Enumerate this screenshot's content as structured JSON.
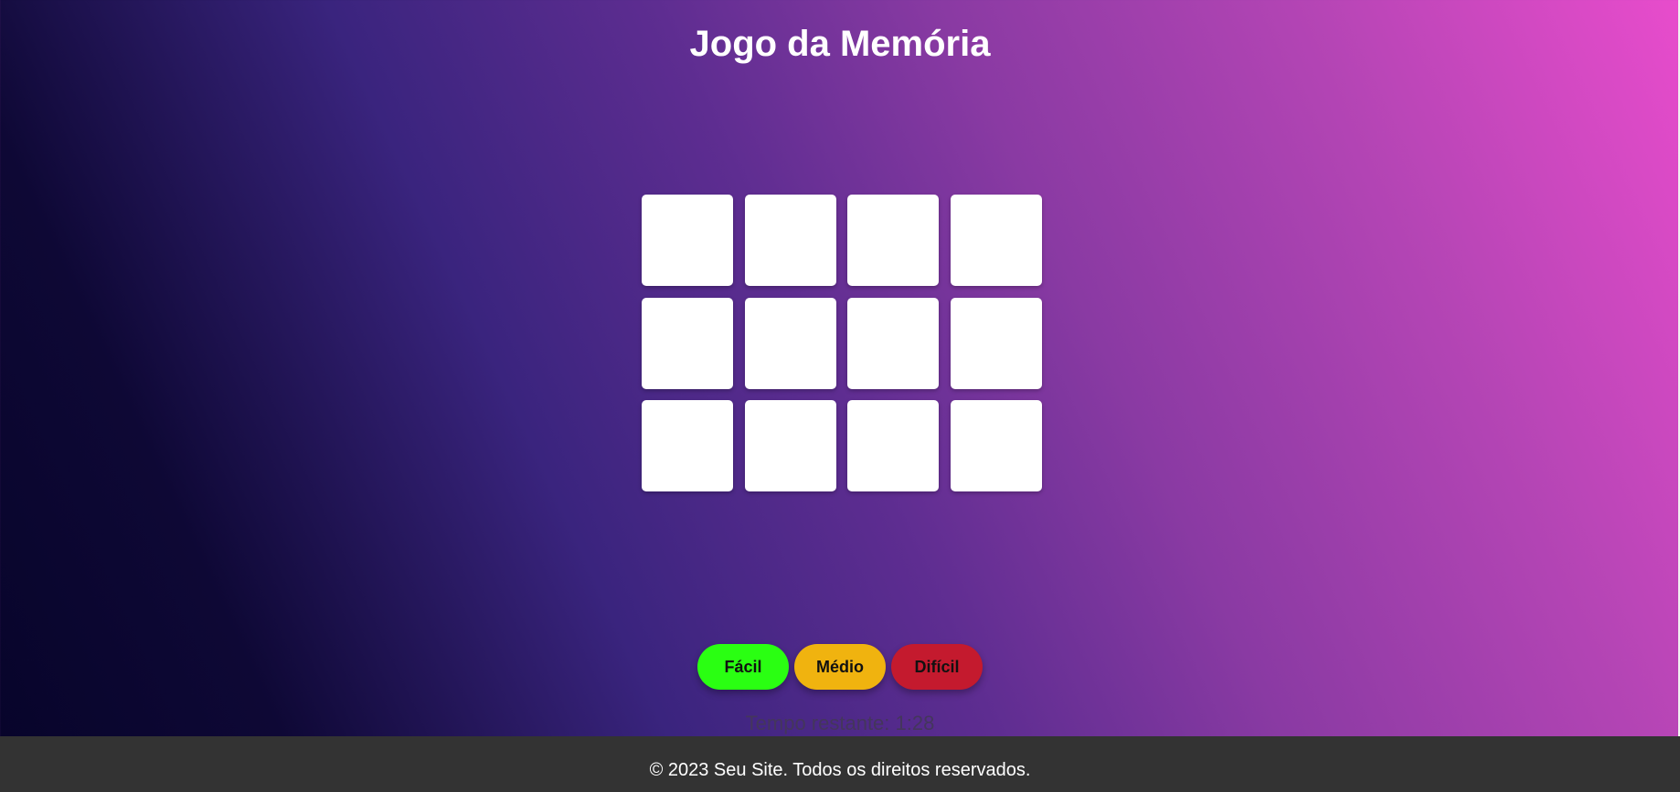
{
  "header": {
    "title": "Jogo da Memória"
  },
  "board": {
    "rows": 3,
    "columns": 4,
    "card_color": "#ffffff"
  },
  "controls": {
    "easy_label": "Fácil",
    "medium_label": "Médio",
    "hard_label": "Difícil",
    "easy_color": "#2aff12",
    "medium_color": "#f0b30f",
    "hard_color": "#c41a2e"
  },
  "status": {
    "timer_text": "Tempo restante: 1:28"
  },
  "footer": {
    "text": "© 2023 Seu Site. Todos os direitos reservados."
  }
}
